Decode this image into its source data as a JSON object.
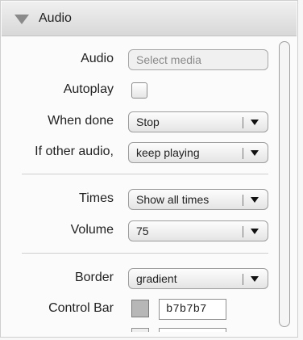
{
  "header": {
    "title": "Audio",
    "toggle_icon": "triangle-down-icon"
  },
  "fields": {
    "audio": {
      "label": "Audio",
      "placeholder": "Select media"
    },
    "autoplay": {
      "label": "Autoplay",
      "checked": false
    },
    "when_done": {
      "label": "When done",
      "value": "Stop"
    },
    "other_audio": {
      "label": "If other audio,",
      "value": "keep playing"
    },
    "times": {
      "label": "Times",
      "value": "Show all times"
    },
    "volume": {
      "label": "Volume",
      "value": "75"
    },
    "border": {
      "label": "Border",
      "value": "gradient"
    },
    "control_bar": {
      "label": "Control Bar",
      "color": "b7b7b7",
      "swatch_color": "#b7b7b7"
    }
  }
}
